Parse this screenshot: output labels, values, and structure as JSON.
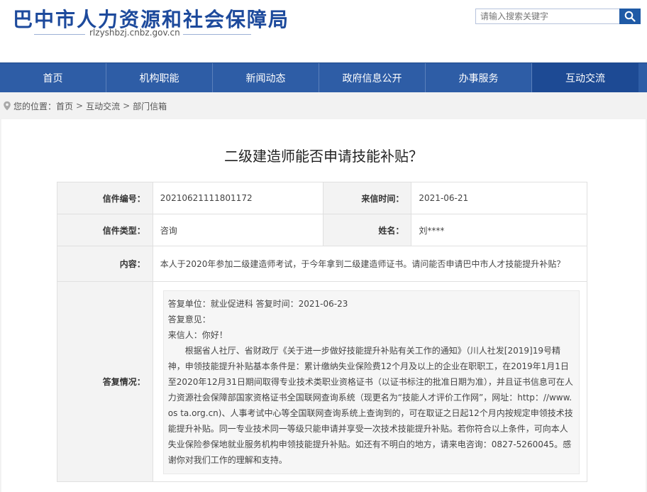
{
  "header": {
    "title": "巴中市人力资源和社会保障局",
    "url": "rlzyshbzj.cnbz.gov.cn",
    "search_placeholder": "请输入搜索关键字"
  },
  "nav": {
    "items": [
      {
        "label": "首页"
      },
      {
        "label": "机构职能"
      },
      {
        "label": "新闻动态"
      },
      {
        "label": "政府信息公开"
      },
      {
        "label": "办事服务"
      },
      {
        "label": "互动交流"
      }
    ]
  },
  "breadcrumb": {
    "prefix": "您的位置：",
    "items": [
      "首页",
      "互动交流",
      "部门信箱"
    ],
    "separator": ">"
  },
  "letter": {
    "title": "二级建造师能否申请技能补贴？",
    "number_label": "信件编号：",
    "number": "20210621111801172",
    "date_label": "来信时间：",
    "date": "2021-06-21",
    "type_label": "信件类型：",
    "type": "咨询",
    "name_label": "姓名：",
    "name": "刘****",
    "content_label": "内容：",
    "content": "本人于2020年参加二级建造师考试，于今年拿到二级建造师证书。请问能否申请巴中市人才技能提升补贴？",
    "reply_label": "答复情况："
  },
  "reply": {
    "unit_line": "答复单位：就业促进科    答复时间：2021-06-23",
    "opinion_label": "答复意见：",
    "greeting": "来信人：你好！",
    "body": "根据省人社厅、省财政厅《关于进一步做好技能提升补贴有关工作的通知》（川人社发[2019]19号精神，申领技能提升补贴基本条件是：累计缴纳失业保险费12个月及以上的企业在职职工，在2019年1月1日至2020年12月31日期间取得专业技术类职业资格证书（以证书标注的批准日期为准），并且证书信息可在人力资源社会保障部国家资格证书全国联网查询系统（现更名为“技能人才评价工作网”，网址：http：//www.os ta.org.cn)、人事考试中心等全国联网查询系统上查询到的，可在取证之日起12个月内按规定申领技术技能提升补贴。同一专业技术同一等级只能申请并享受一次技术技能提升补贴。若你符合以上条件，可向本人失业保险参保地就业服务机构申领技能提升补贴。如还有不明白的地方，请来电咨询：0827-5260045。感谢你对我们工作的理解和支持。"
  },
  "colors": {
    "brand_blue": "#1d4a9c",
    "nav_blue": "#2e5da6",
    "nav_active": "#1d4a94"
  },
  "icons": {
    "search": "search-icon",
    "location": "location-pin-icon"
  }
}
